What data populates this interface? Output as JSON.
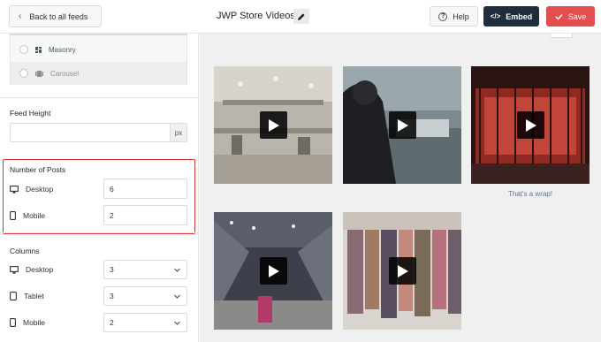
{
  "header": {
    "back_label": "Back to all feeds",
    "title": "JWP Store Videos",
    "help_label": "Help",
    "embed_label": "Embed",
    "save_label": "Save"
  },
  "sidebar": {
    "layout_options": [
      {
        "label": "Masonry",
        "icon": "masonry-icon"
      },
      {
        "label": "Carousel",
        "icon": "carousel-icon"
      }
    ],
    "feed_height": {
      "label": "Feed Height",
      "value": "",
      "suffix": "px"
    },
    "number_of_posts": {
      "label": "Number of Posts",
      "desktop_label": "Desktop",
      "desktop_value": "6",
      "mobile_label": "Mobile",
      "mobile_value": "2"
    },
    "columns": {
      "label": "Columns",
      "desktop_label": "Desktop",
      "desktop_value": "3",
      "tablet_label": "Tablet",
      "tablet_value": "3",
      "mobile_label": "Mobile",
      "mobile_value": "2"
    }
  },
  "preview": {
    "videos": [
      {
        "scene": "mall atrium interior"
      },
      {
        "scene": "worker at sewing machine"
      },
      {
        "scene": "red lit storefront"
      },
      {
        "scene": "street with lights at night"
      },
      {
        "scene": "clothing rack"
      }
    ],
    "caption": "That's a wrap!"
  },
  "colors": {
    "embed_bg": "#1f2d3d",
    "save_bg": "#e34f4f",
    "highlight": "#d63638",
    "caption": "#4a7aa8"
  }
}
